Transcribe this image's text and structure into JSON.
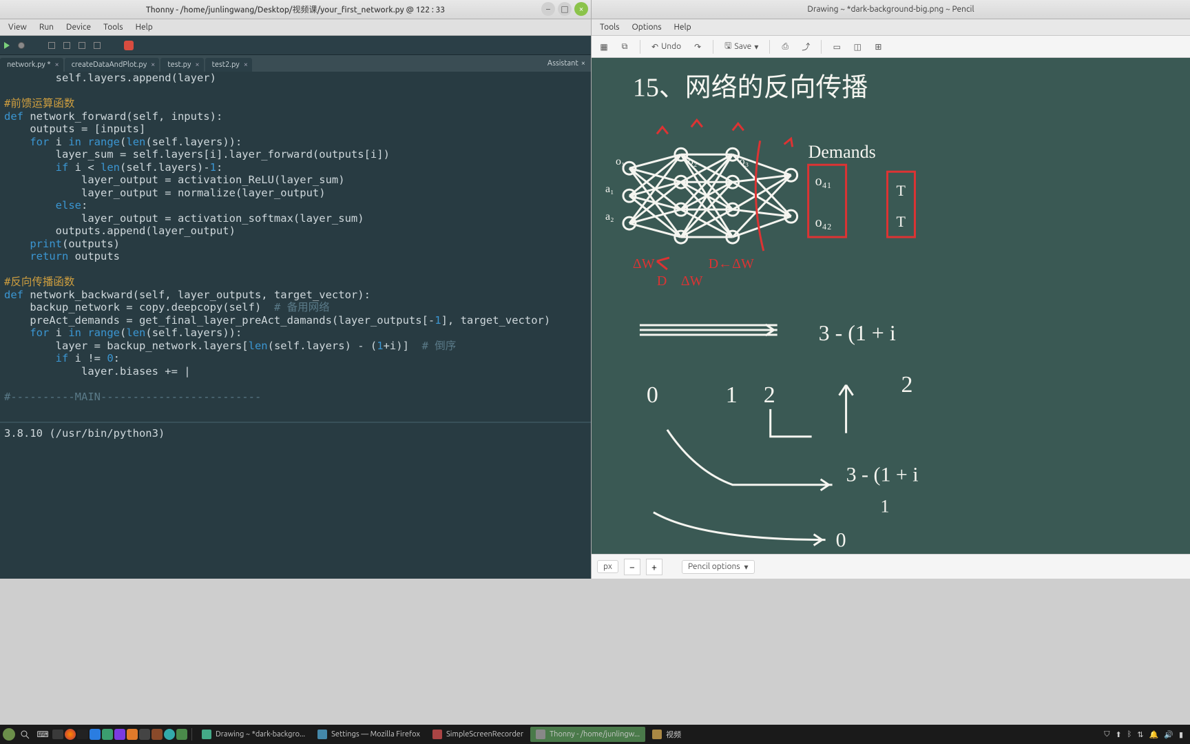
{
  "thonny": {
    "title": "Thonny  -  /home/junlingwang/Desktop/视频课/your_first_network.py  @  122 : 33",
    "menu": {
      "view": "View",
      "run": "Run",
      "device": "Device",
      "tools": "Tools",
      "help": "Help"
    },
    "tabs": [
      {
        "label": "network.py *"
      },
      {
        "label": "createDataAndPlot.py"
      },
      {
        "label": "test.py"
      },
      {
        "label": "test2.py"
      }
    ],
    "assistant_label": "Assistant",
    "code_lines": [
      {
        "t": "            self.layers.append(layer)"
      },
      {
        "t": ""
      },
      {
        "t": "    #前馈运算函数",
        "cls": "cmtc"
      },
      {
        "t": "    def network_forward(self, inputs):"
      },
      {
        "t": "        outputs = [inputs]"
      },
      {
        "t": "        for i in range(len(self.layers)):"
      },
      {
        "t": "            layer_sum = self.layers[i].layer_forward(outputs[i])"
      },
      {
        "t": "            if i < len(self.layers)-1:"
      },
      {
        "t": "                layer_output = activation_ReLU(layer_sum)"
      },
      {
        "t": "                layer_output = normalize(layer_output)"
      },
      {
        "t": "            else:"
      },
      {
        "t": "                layer_output = activation_softmax(layer_sum)"
      },
      {
        "t": "            outputs.append(layer_output)"
      },
      {
        "t": "        print(outputs)"
      },
      {
        "t": "        return outputs"
      },
      {
        "t": ""
      },
      {
        "t": "    #反向传播函数",
        "cls": "cmtc"
      },
      {
        "t": "    def network_backward(self, layer_outputs, target_vector):"
      },
      {
        "t": "        backup_network = copy.deepcopy(self) # 备用网络"
      },
      {
        "t": "        preAct_demands = get_final_layer_preAct_damands(layer_outputs[-1], target_vector)"
      },
      {
        "t": "        for i in range(len(self.layers)):"
      },
      {
        "t": "            layer = backup_network.layers[len(self.layers) - (1+i)] # 倒序"
      },
      {
        "t": "            if i != 0:"
      },
      {
        "t": "                layer.biases += |"
      },
      {
        "t": ""
      },
      {
        "t": "#----------MAIN-------------------------",
        "cls": "cmt-sep"
      }
    ],
    "shell": {
      "prompt": "3.8.10 (/usr/bin/python3)"
    }
  },
  "pencil": {
    "title": "Drawing ~ *dark-background-big.png ~ Pencil",
    "menu": {
      "tools": "Tools",
      "options": "Options",
      "help": "Help"
    },
    "toolbar": {
      "undo": "Undo",
      "save": "Save"
    },
    "status": {
      "unit": "px",
      "options": "Pencil options"
    },
    "whiteboard": {
      "title": "15、网络的反向传播",
      "demands": "Demands",
      "node_labels": [
        "o₁",
        "o₂",
        "o₃",
        "a₁",
        "a₂",
        "o₄₁",
        "o₄₂",
        "T",
        "T"
      ],
      "dw_labels": [
        "ΔW",
        "D",
        "ΔW",
        "D",
        "ΔW"
      ],
      "expr1": "3 - (1 + i",
      "expr2": "3 - (1 + i",
      "nums": [
        "0",
        "1",
        "2",
        "2",
        "0"
      ]
    }
  },
  "taskbar": {
    "apps": [
      {
        "label": "Drawing ~ *dark-backgro...",
        "icon": "#4a8"
      },
      {
        "label": "Settings — Mozilla Firefox",
        "icon": "#48a"
      },
      {
        "label": "SimpleScreenRecorder",
        "icon": "#a44"
      },
      {
        "label": "Thonny  -  /home/junlingw...",
        "icon": "#888",
        "active": true
      },
      {
        "label": "视频",
        "icon": "#a84"
      }
    ]
  }
}
